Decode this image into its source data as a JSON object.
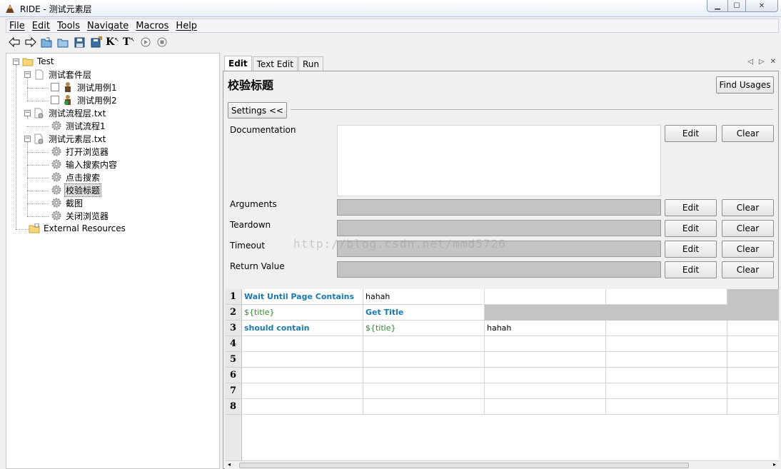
{
  "window": {
    "title": "RIDE - 测试元素层"
  },
  "menu": [
    {
      "label": "File"
    },
    {
      "label": "Edit"
    },
    {
      "label": "Tools"
    },
    {
      "label": "Navigate"
    },
    {
      "label": "Macros"
    },
    {
      "label": "Help"
    }
  ],
  "toolbar": {
    "buttons": [
      "back-arrow-icon",
      "forward-arrow-icon",
      "open-suite-icon",
      "open-directory-icon",
      "save-icon",
      "save-all-icon",
      "search-keywords-icon",
      "search-tests-icon",
      "run-icon",
      "stop-icon"
    ],
    "k_label": "K",
    "t_label": "T"
  },
  "tree": {
    "root": "Test",
    "suite": "测试套件层",
    "tests": [
      "测试用例1",
      "测试用例2"
    ],
    "flow_file": "测试流程层.txt",
    "flow_keywords": [
      "测试流程1"
    ],
    "element_file": "测试元素层.txt",
    "element_keywords": [
      "打开浏览器",
      "输入搜索内容",
      "点击搜索",
      "校验标题",
      "截图",
      "关闭浏览器"
    ],
    "external": "External Resources"
  },
  "tabs": [
    {
      "label": "Edit"
    },
    {
      "label": "Text Edit"
    },
    {
      "label": "Run"
    }
  ],
  "editor": {
    "keyword_name": "校验标题",
    "find_usages": "Find Usages",
    "settings_toggle": "Settings <<",
    "documentation_label": "Documentation",
    "arguments_label": "Arguments",
    "teardown_label": "Teardown",
    "timeout_label": "Timeout",
    "return_value_label": "Return Value",
    "edit_label": "Edit",
    "clear_label": "Clear",
    "watermark": "http://blog.csdn.net/mmd5726"
  },
  "grid": {
    "row_numbers": [
      "1",
      "2",
      "3",
      "4",
      "5",
      "6",
      "7",
      "8"
    ],
    "rows": [
      [
        "Wait Until Page Contains",
        "hahah",
        "",
        "",
        ""
      ],
      [
        "${title}",
        "Get Title",
        "",
        "",
        ""
      ],
      [
        "should contain",
        "${title}",
        "hahah",
        "",
        ""
      ]
    ]
  },
  "colors": {
    "keyword": "#1a7ab0",
    "variable": "#2e8b2e",
    "disabled_field": "#c4c4c4"
  }
}
